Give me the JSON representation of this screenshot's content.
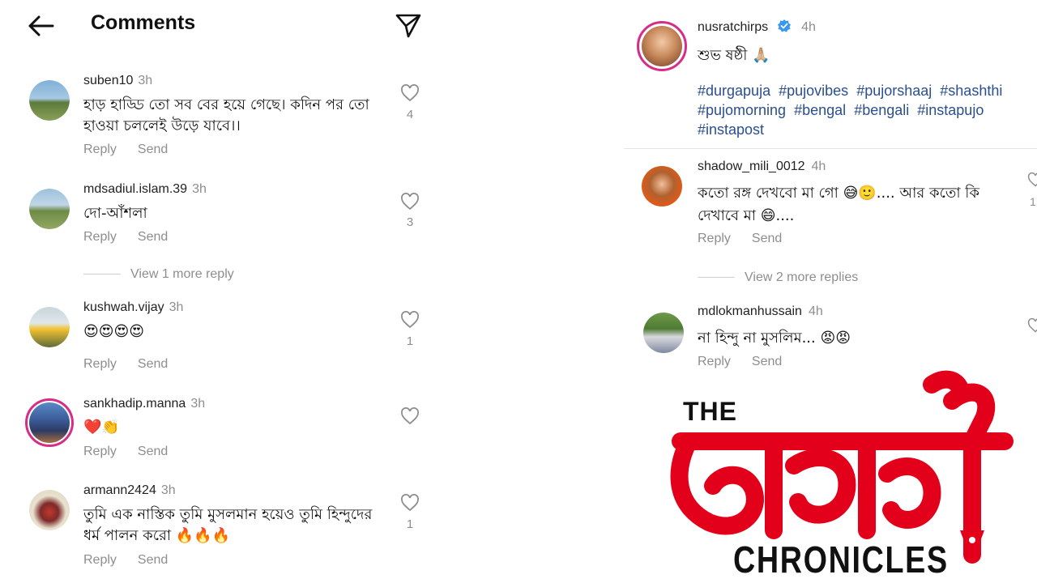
{
  "header": {
    "title": "Comments"
  },
  "comments": [
    {
      "user": "suben10",
      "time": "3h",
      "text": "হাড় হাড্ডি তো সব বের হয়ে গেছে। কদিন পর তো হাওয়া চললেই উড়ে যাবে।।",
      "likes": "4",
      "reply": "Reply",
      "send": "Send"
    },
    {
      "user": "mdsadiul.islam.39",
      "time": "3h",
      "text": "দো-আঁশলা",
      "likes": "3",
      "reply": "Reply",
      "send": "Send",
      "view_more": "View 1 more reply"
    },
    {
      "user": "kushwah.vijay",
      "time": "3h",
      "text": "😍😍😍😍",
      "likes": "1",
      "reply": "Reply",
      "send": "Send"
    },
    {
      "user": "sankhadip.manna",
      "time": "3h",
      "text": "❤️👏",
      "likes": "",
      "reply": "Reply",
      "send": "Send"
    },
    {
      "user": "armann2424",
      "time": "3h",
      "text": "তুমি এক নাস্তিক তুমি মুসলমান হয়েও তুমি হিন্দুদের ধর্ম পালন করো 🔥🔥🔥",
      "likes": "1",
      "reply": "Reply",
      "send": "Send"
    }
  ],
  "post": {
    "user": "nusratchirps",
    "time": "4h",
    "caption": "শুভ ষষ্ঠী 🙏🏼",
    "hashtags": [
      "#durgapuja",
      "#pujovibes",
      "#pujorshaaj",
      "#shashthi",
      "#pujomorning",
      "#bengal",
      "#bengali",
      "#instapujo",
      "#instapost"
    ]
  },
  "right_comments": [
    {
      "user": "shadow_mili_0012",
      "time": "4h",
      "text": "কতো রঙ্গ দেখবো মা গো 😅🙂.... আর কতো কি দেখাবে মা 😄....",
      "likes": "1",
      "reply": "Reply",
      "send": "Send",
      "view_more": "View 2 more replies"
    },
    {
      "user": "mdlokmanhussain",
      "time": "4h",
      "text": "না হিন্দু না মুসলিম... 😡😡",
      "reply": "Reply",
      "send": "Send"
    }
  ],
  "logo": {
    "the": "THE",
    "name": "বেঙ্গলী",
    "chronicles": "CHRONICLES",
    "color": "#e3001b"
  },
  "colors": {
    "link": "#2a4f8f",
    "muted": "#8e8e8e",
    "story_ring": "#d62e88",
    "verified": "#3897f0"
  },
  "icons": [
    "back-arrow-icon",
    "share-send-icon",
    "heart-icon",
    "verified-icon"
  ]
}
